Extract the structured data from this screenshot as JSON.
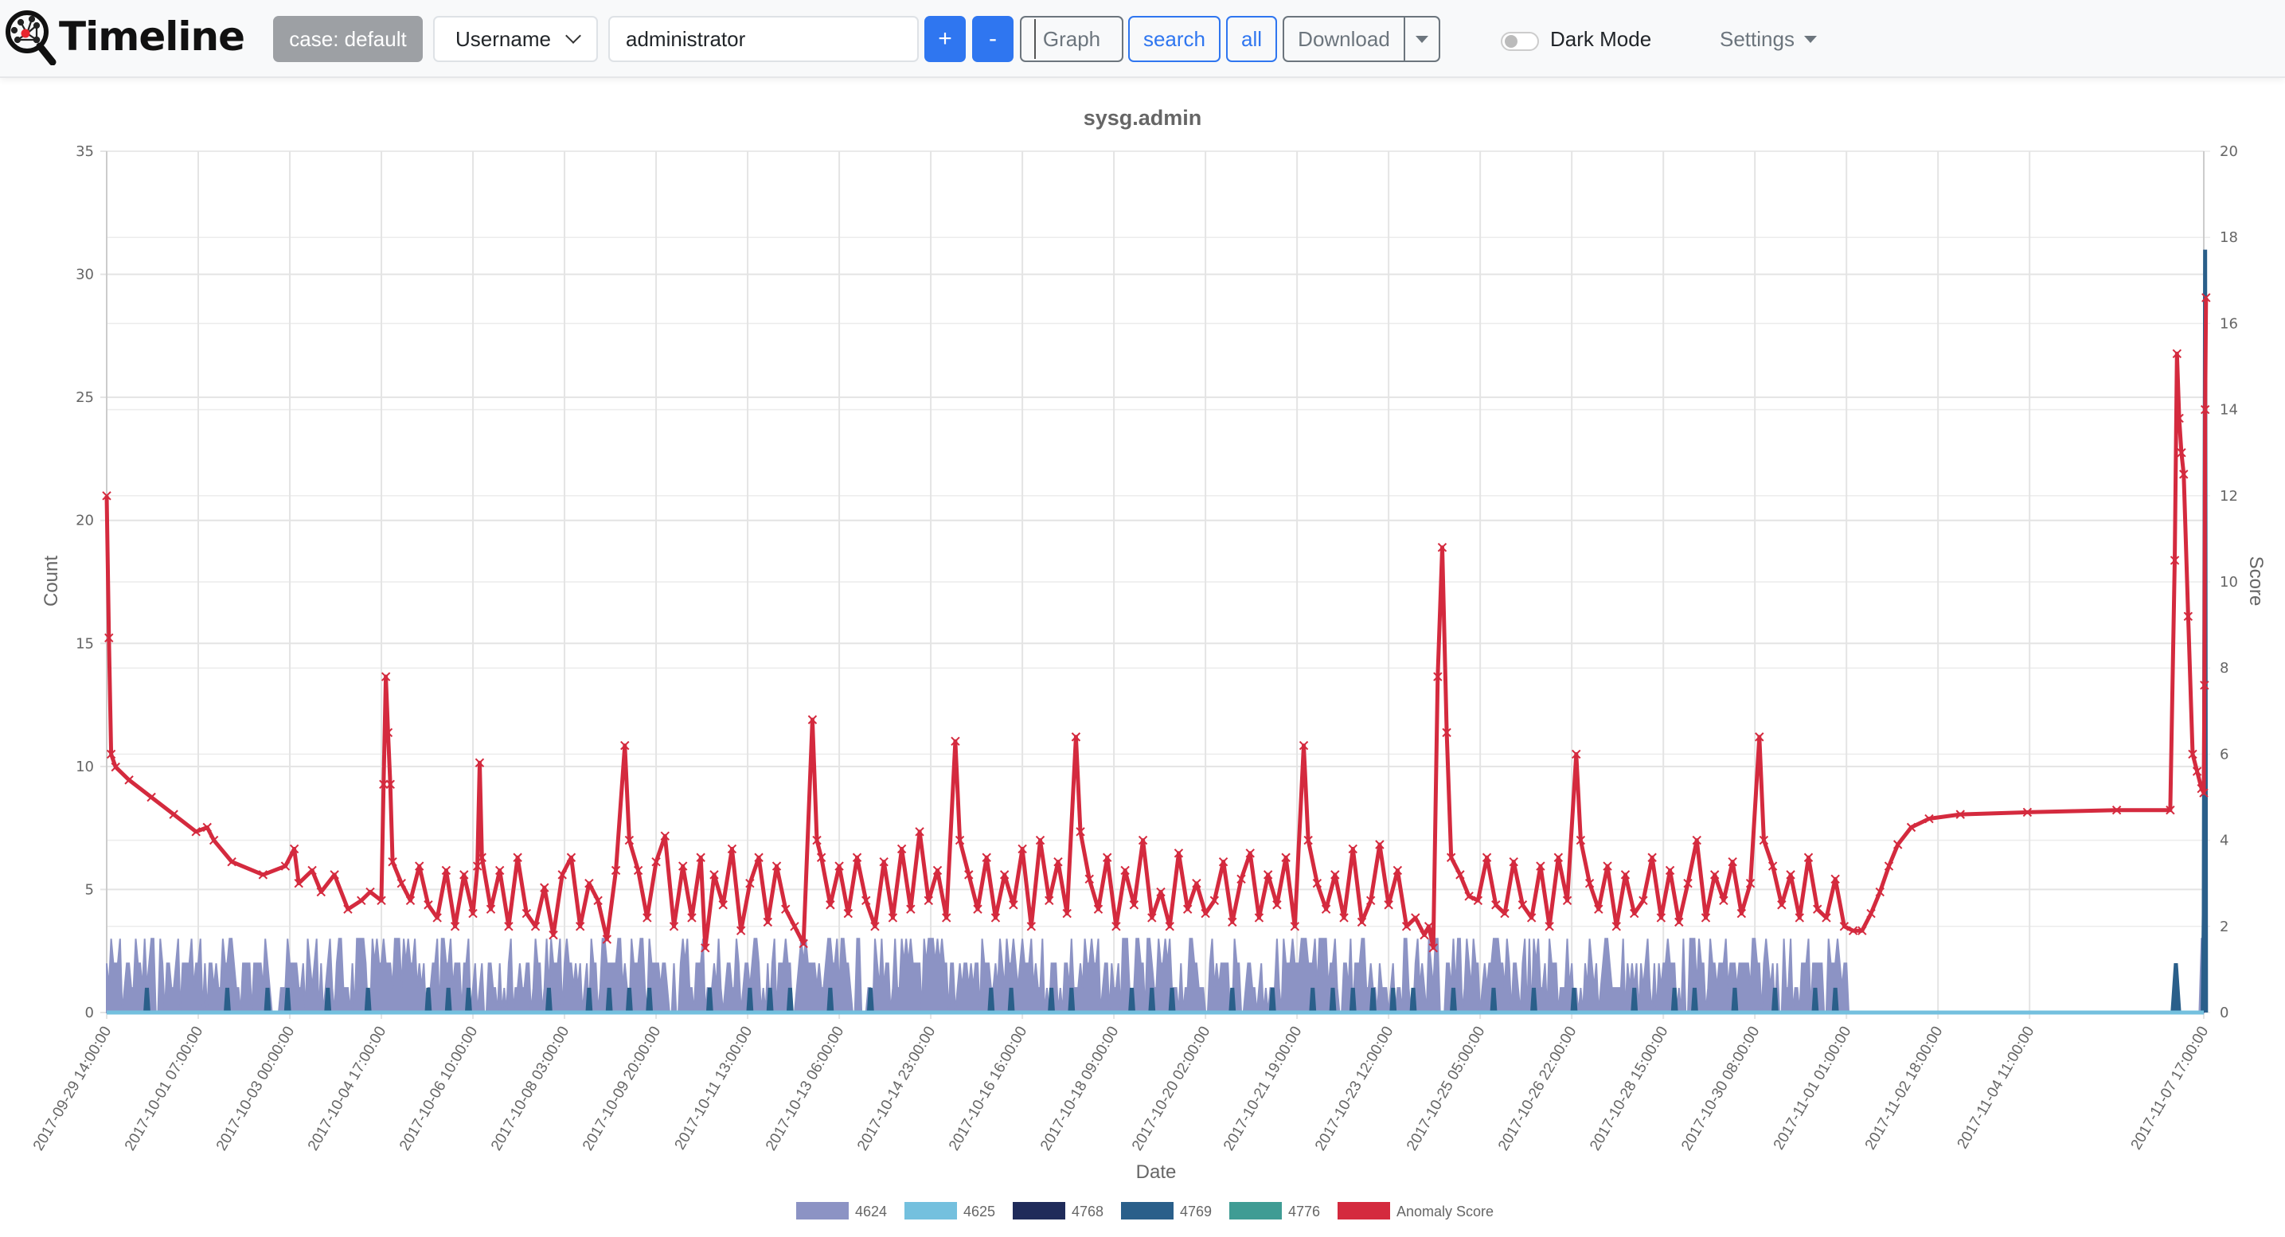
{
  "navbar": {
    "brand": "Timeline",
    "case_badge": "case: default",
    "field_select": "Username",
    "search_value": "administrator",
    "plus_label": "+",
    "minus_label": "-",
    "graph_label": "Graph",
    "search_label": "search",
    "all_label": "all",
    "download_label": "Download",
    "dark_mode_label": "Dark Mode",
    "dark_mode_on": false,
    "settings_label": "Settings"
  },
  "chart_data": {
    "type": "line",
    "title": "sysg.admin",
    "xlabel": "Date",
    "ylabel": "Count",
    "y2label": "Score",
    "ylim": [
      0,
      35
    ],
    "y2lim": [
      0,
      20
    ],
    "yticks": [
      0,
      5,
      10,
      15,
      20,
      25,
      30,
      35
    ],
    "y2ticks": [
      0,
      2,
      4,
      6,
      8,
      10,
      12,
      14,
      16,
      18,
      20
    ],
    "grid": true,
    "legend_position": "bottom",
    "x_tick_labels": [
      "2017-09-29 14:00:00",
      "2017-10-01 07:00:00",
      "2017-10-03 00:00:00",
      "2017-10-04 17:00:00",
      "2017-10-06 10:00:00",
      "2017-10-08 03:00:00",
      "2017-10-09 20:00:00",
      "2017-10-11 13:00:00",
      "2017-10-13 06:00:00",
      "2017-10-14 23:00:00",
      "2017-10-16 16:00:00",
      "2017-10-18 09:00:00",
      "2017-10-20 02:00:00",
      "2017-10-21 19:00:00",
      "2017-10-23 12:00:00",
      "2017-10-25 05:00:00",
      "2017-10-26 22:00:00",
      "2017-10-28 15:00:00",
      "2017-10-30 08:00:00",
      "2017-11-01 01:00:00",
      "2017-11-02 18:00:00",
      "2017-11-04 11:00:00",
      "2017-11-07 17:00:00"
    ],
    "x_tick_positions_hours": [
      0,
      41,
      82,
      123,
      164,
      205,
      246,
      287,
      328,
      369,
      410,
      451,
      492,
      533,
      574,
      615,
      656,
      697,
      738,
      779,
      820,
      861,
      939
    ],
    "x_range_hours": [
      0,
      939
    ],
    "series": [
      {
        "name": "4624",
        "color": "#8c93c4",
        "axis": "left",
        "pattern": "hourly counts 0-3 from 2017-09-29 14:00 to 2017-11-01 01:00, then 0; spike 1 near 2017-11-06, 3 at end",
        "values_sampled": [
          2,
          3,
          0,
          2,
          3,
          1,
          2,
          0,
          3,
          2,
          1,
          3,
          0,
          2,
          3,
          2,
          0,
          1,
          3,
          2
        ]
      },
      {
        "name": "4625",
        "color": "#74c0de",
        "axis": "left",
        "values_sampled": [
          0,
          0,
          0,
          0,
          0
        ]
      },
      {
        "name": "4768",
        "color": "#1f2b5a",
        "axis": "left",
        "values_sampled": [
          0,
          0,
          0,
          0,
          0
        ]
      },
      {
        "name": "4769",
        "color": "#2a5f8a",
        "axis": "left",
        "pattern": "occasional 1s during first period; 2 near 2017-11-06; 31 at last point",
        "end_values": {
          "2017-11-06": 2,
          "2017-11-07 16:00": 4,
          "2017-11-07 17:00": 31
        }
      },
      {
        "name": "4776",
        "color": "#3f9c94",
        "axis": "left",
        "values_sampled": [
          0,
          0,
          0,
          0,
          0
        ]
      },
      {
        "name": "Anomaly Score",
        "color": "#d42a3e",
        "axis": "right",
        "points": [
          [
            0,
            12.0
          ],
          [
            1,
            8.7
          ],
          [
            2,
            6.0
          ],
          [
            4,
            5.7
          ],
          [
            10,
            5.4
          ],
          [
            20,
            5.0
          ],
          [
            30,
            4.6
          ],
          [
            40,
            4.2
          ],
          [
            45,
            4.3
          ],
          [
            48,
            4.0
          ],
          [
            56,
            3.5
          ],
          [
            70,
            3.2
          ],
          [
            80,
            3.4
          ],
          [
            84,
            3.8
          ],
          [
            86,
            3.0
          ],
          [
            92,
            3.3
          ],
          [
            96,
            2.8
          ],
          [
            102,
            3.2
          ],
          [
            108,
            2.4
          ],
          [
            114,
            2.6
          ],
          [
            118,
            2.8
          ],
          [
            123,
            2.6
          ],
          [
            124,
            5.3
          ],
          [
            125,
            7.8
          ],
          [
            126,
            6.5
          ],
          [
            127,
            5.3
          ],
          [
            128,
            3.5
          ],
          [
            132,
            3.0
          ],
          [
            136,
            2.6
          ],
          [
            140,
            3.4
          ],
          [
            144,
            2.5
          ],
          [
            148,
            2.2
          ],
          [
            152,
            3.3
          ],
          [
            156,
            2.0
          ],
          [
            160,
            3.2
          ],
          [
            164,
            2.3
          ],
          [
            166,
            3.4
          ],
          [
            167,
            5.8
          ],
          [
            168,
            3.6
          ],
          [
            172,
            2.4
          ],
          [
            176,
            3.3
          ],
          [
            180,
            2.0
          ],
          [
            184,
            3.6
          ],
          [
            188,
            2.3
          ],
          [
            192,
            2.0
          ],
          [
            196,
            2.9
          ],
          [
            200,
            1.8
          ],
          [
            204,
            3.2
          ],
          [
            208,
            3.6
          ],
          [
            212,
            2.0
          ],
          [
            216,
            3.0
          ],
          [
            220,
            2.6
          ],
          [
            224,
            1.7
          ],
          [
            228,
            3.3
          ],
          [
            232,
            6.2
          ],
          [
            234,
            4.0
          ],
          [
            238,
            3.3
          ],
          [
            242,
            2.2
          ],
          [
            246,
            3.5
          ],
          [
            250,
            4.1
          ],
          [
            254,
            2.0
          ],
          [
            258,
            3.4
          ],
          [
            262,
            2.2
          ],
          [
            266,
            3.6
          ],
          [
            268,
            1.5
          ],
          [
            272,
            3.2
          ],
          [
            276,
            2.5
          ],
          [
            280,
            3.8
          ],
          [
            284,
            1.9
          ],
          [
            288,
            3.0
          ],
          [
            292,
            3.6
          ],
          [
            296,
            2.1
          ],
          [
            300,
            3.4
          ],
          [
            304,
            2.4
          ],
          [
            308,
            2.0
          ],
          [
            312,
            1.6
          ],
          [
            316,
            6.8
          ],
          [
            318,
            4.0
          ],
          [
            320,
            3.6
          ],
          [
            324,
            2.5
          ],
          [
            328,
            3.4
          ],
          [
            332,
            2.3
          ],
          [
            336,
            3.6
          ],
          [
            340,
            2.6
          ],
          [
            344,
            2.0
          ],
          [
            348,
            3.5
          ],
          [
            352,
            2.2
          ],
          [
            356,
            3.8
          ],
          [
            360,
            2.4
          ],
          [
            364,
            4.2
          ],
          [
            368,
            2.6
          ],
          [
            372,
            3.3
          ],
          [
            376,
            2.2
          ],
          [
            380,
            6.3
          ],
          [
            382,
            4.0
          ],
          [
            386,
            3.2
          ],
          [
            390,
            2.4
          ],
          [
            394,
            3.6
          ],
          [
            398,
            2.2
          ],
          [
            402,
            3.2
          ],
          [
            406,
            2.5
          ],
          [
            410,
            3.8
          ],
          [
            414,
            2.0
          ],
          [
            418,
            4.0
          ],
          [
            422,
            2.6
          ],
          [
            426,
            3.5
          ],
          [
            430,
            2.3
          ],
          [
            434,
            6.4
          ],
          [
            436,
            4.2
          ],
          [
            440,
            3.1
          ],
          [
            444,
            2.4
          ],
          [
            448,
            3.6
          ],
          [
            452,
            2.0
          ],
          [
            456,
            3.3
          ],
          [
            460,
            2.5
          ],
          [
            464,
            4.0
          ],
          [
            468,
            2.2
          ],
          [
            472,
            2.8
          ],
          [
            476,
            2.0
          ],
          [
            480,
            3.7
          ],
          [
            484,
            2.4
          ],
          [
            488,
            3.0
          ],
          [
            492,
            2.3
          ],
          [
            496,
            2.6
          ],
          [
            500,
            3.5
          ],
          [
            504,
            2.1
          ],
          [
            508,
            3.1
          ],
          [
            512,
            3.7
          ],
          [
            516,
            2.2
          ],
          [
            520,
            3.2
          ],
          [
            524,
            2.5
          ],
          [
            528,
            3.6
          ],
          [
            532,
            2.0
          ],
          [
            536,
            6.2
          ],
          [
            538,
            4.0
          ],
          [
            542,
            3.0
          ],
          [
            546,
            2.4
          ],
          [
            550,
            3.2
          ],
          [
            554,
            2.2
          ],
          [
            558,
            3.8
          ],
          [
            562,
            2.1
          ],
          [
            566,
            2.6
          ],
          [
            570,
            3.9
          ],
          [
            574,
            2.5
          ],
          [
            578,
            3.3
          ],
          [
            582,
            2.0
          ],
          [
            586,
            2.2
          ],
          [
            590,
            1.8
          ],
          [
            592,
            2.0
          ],
          [
            594,
            1.5
          ],
          [
            596,
            7.8
          ],
          [
            598,
            10.8
          ],
          [
            600,
            6.5
          ],
          [
            602,
            3.6
          ],
          [
            606,
            3.2
          ],
          [
            610,
            2.7
          ],
          [
            614,
            2.6
          ],
          [
            618,
            3.6
          ],
          [
            622,
            2.5
          ],
          [
            626,
            2.3
          ],
          [
            630,
            3.5
          ],
          [
            634,
            2.5
          ],
          [
            638,
            2.2
          ],
          [
            642,
            3.4
          ],
          [
            646,
            2.0
          ],
          [
            650,
            3.6
          ],
          [
            654,
            2.6
          ],
          [
            658,
            6.0
          ],
          [
            660,
            4.0
          ],
          [
            664,
            3.0
          ],
          [
            668,
            2.4
          ],
          [
            672,
            3.4
          ],
          [
            676,
            2.0
          ],
          [
            680,
            3.2
          ],
          [
            684,
            2.3
          ],
          [
            688,
            2.6
          ],
          [
            692,
            3.6
          ],
          [
            696,
            2.2
          ],
          [
            700,
            3.3
          ],
          [
            704,
            2.1
          ],
          [
            708,
            3.0
          ],
          [
            712,
            4.0
          ],
          [
            716,
            2.2
          ],
          [
            720,
            3.2
          ],
          [
            724,
            2.6
          ],
          [
            728,
            3.5
          ],
          [
            732,
            2.3
          ],
          [
            736,
            3.0
          ],
          [
            740,
            6.4
          ],
          [
            742,
            4.0
          ],
          [
            746,
            3.4
          ],
          [
            750,
            2.5
          ],
          [
            754,
            3.2
          ],
          [
            758,
            2.2
          ],
          [
            762,
            3.6
          ],
          [
            766,
            2.4
          ],
          [
            770,
            2.2
          ],
          [
            774,
            3.1
          ],
          [
            778,
            2.0
          ],
          [
            782,
            1.9
          ],
          [
            786,
            1.9
          ],
          [
            790,
            2.3
          ],
          [
            794,
            2.8
          ],
          [
            798,
            3.4
          ],
          [
            802,
            3.9
          ],
          [
            808,
            4.3
          ],
          [
            816,
            4.5
          ],
          [
            830,
            4.6
          ],
          [
            860,
            4.65
          ],
          [
            900,
            4.7
          ],
          [
            924,
            4.7
          ],
          [
            926,
            10.5
          ],
          [
            927,
            15.3
          ],
          [
            928,
            13.8
          ],
          [
            929,
            13.0
          ],
          [
            930,
            12.5
          ],
          [
            932,
            9.2
          ],
          [
            934,
            6.0
          ],
          [
            936,
            5.6
          ],
          [
            938,
            5.2
          ],
          [
            939,
            5.1
          ],
          [
            939.3,
            7.6
          ],
          [
            939.6,
            14.0
          ],
          [
            940,
            16.6
          ]
        ]
      }
    ]
  }
}
